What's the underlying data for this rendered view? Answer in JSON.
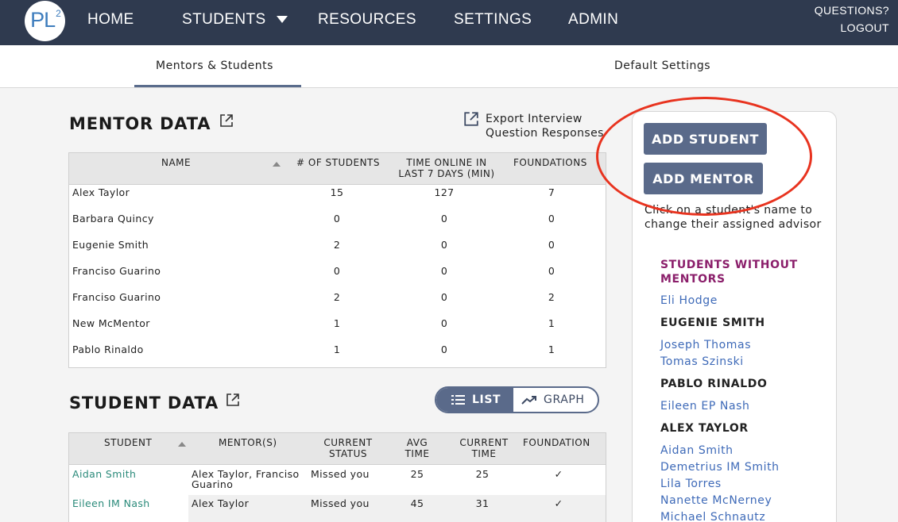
{
  "nav": {
    "logo": "PL",
    "logo_sup": "2",
    "items": [
      "HOME",
      "STUDENTS",
      "RESOURCES",
      "SETTINGS",
      "ADMIN"
    ],
    "questions": "QUESTIONS?",
    "logout": "LOGOUT"
  },
  "subtabs": {
    "active": "Mentors & Students",
    "other": "Default Settings"
  },
  "mentor_section": {
    "title": "MENTOR DATA",
    "export_line1": "Export Interview",
    "export_line2": "Question Responses",
    "columns": {
      "name": "NAME",
      "students": "# OF STUDENTS",
      "time_line1": "TIME ONLINE IN",
      "time_line2": "LAST 7 DAYS (MIN)",
      "foundations": "FOUNDATIONS"
    },
    "rows": [
      {
        "name": "Alex Taylor",
        "students": "15",
        "time": "127",
        "foundations": "7"
      },
      {
        "name": "Barbara Quincy",
        "students": "0",
        "time": "0",
        "foundations": "0"
      },
      {
        "name": "Eugenie Smith",
        "students": "2",
        "time": "0",
        "foundations": "0"
      },
      {
        "name": "Franciso Guarino",
        "students": "0",
        "time": "0",
        "foundations": "0"
      },
      {
        "name": "Franciso Guarino",
        "students": "2",
        "time": "0",
        "foundations": "2"
      },
      {
        "name": "New McMentor",
        "students": "1",
        "time": "0",
        "foundations": "1"
      },
      {
        "name": "Pablo Rinaldo",
        "students": "1",
        "time": "0",
        "foundations": "1"
      }
    ]
  },
  "student_section": {
    "title": "STUDENT DATA",
    "toggle_list": "LIST",
    "toggle_graph": "GRAPH",
    "columns": {
      "student": "STUDENT",
      "mentors": "MENTOR(S)",
      "status_line1": "CURRENT",
      "status_line2": "STATUS",
      "avg_line1": "AVG",
      "avg_line2": "TIME",
      "cur_line1": "CURRENT",
      "cur_line2": "TIME",
      "foundation": "FOUNDATION"
    },
    "rows": [
      {
        "student": "Aidan Smith",
        "mentors_line1": "Alex Taylor, Franciso",
        "mentors_line2": "Guarino",
        "status": "Missed you",
        "avg": "25",
        "current": "25",
        "foundation": "✓"
      },
      {
        "student": "Eileen IM Nash",
        "mentors_line1": "Alex Taylor",
        "mentors_line2": "",
        "status": "Missed you",
        "avg": "45",
        "current": "31",
        "foundation": "✓"
      }
    ]
  },
  "panel": {
    "add_student": "ADD STUDENT",
    "add_mentor": "ADD MENTOR",
    "help": "Click on a student's name to change their assigned advisor",
    "groups": [
      {
        "heading": "STUDENTS WITHOUT MENTORS",
        "students": [
          "Eli Hodge"
        ]
      },
      {
        "heading": "EUGENIE SMITH",
        "students": [
          "Joseph Thomas",
          "Tomas Szinski"
        ]
      },
      {
        "heading": "PABLO RINALDO",
        "students": [
          "Eileen EP Nash"
        ]
      },
      {
        "heading": "ALEX TAYLOR",
        "students": [
          "Aidan Smith",
          "Demetrius IM Smith",
          "Lila Torres",
          "Nanette McNerney",
          "Michael Schnautz"
        ]
      }
    ]
  },
  "colors": {
    "nav_bg": "#2f3a4f",
    "button": "#5a6a8a",
    "link": "#3e6ab8",
    "purple_heading": "#8b1f6b",
    "highlight": "#e8331f"
  }
}
